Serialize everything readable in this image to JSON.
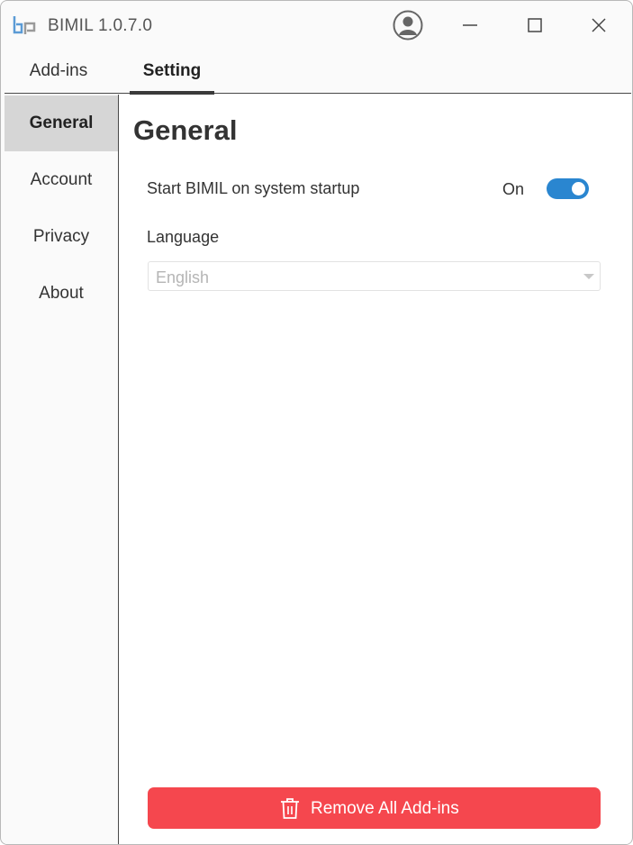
{
  "window": {
    "title": "BIMIL 1.0.7.0",
    "accent": "#2a86d0",
    "danger": "#f5474e"
  },
  "top_tabs": [
    {
      "label": "Add-ins",
      "active": false
    },
    {
      "label": "Setting",
      "active": true
    }
  ],
  "sidebar": {
    "items": [
      {
        "label": "General",
        "active": true
      },
      {
        "label": "Account",
        "active": false
      },
      {
        "label": "Privacy",
        "active": false
      },
      {
        "label": "About",
        "active": false
      }
    ]
  },
  "main": {
    "title": "General",
    "startup": {
      "label": "Start BIMIL on system startup",
      "state": "On",
      "enabled": true
    },
    "language": {
      "label": "Language",
      "value": "English"
    },
    "remove_button": {
      "label": "Remove All Add-ins",
      "icon": "trash-icon"
    }
  },
  "icons": {
    "logo": "bimil-logo",
    "user": "user-account-icon",
    "minimize": "minimize-icon",
    "maximize": "maximize-icon",
    "close": "close-icon"
  }
}
